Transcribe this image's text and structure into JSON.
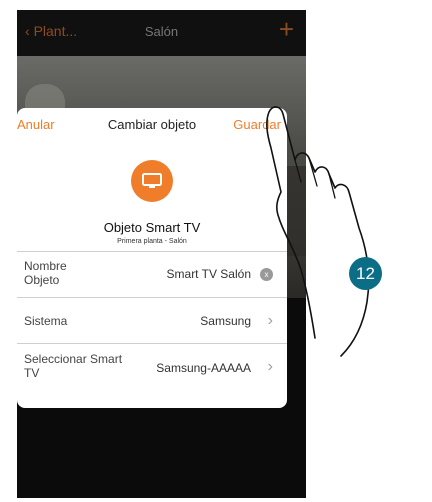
{
  "navbar": {
    "back": "Plant...",
    "title": "Salón",
    "add": "+"
  },
  "modal": {
    "cancel": "Anular",
    "title": "Cambiar objeto",
    "save": "Guardar",
    "object_name": "Objeto Smart TV",
    "object_location": "Primera planta - Salón",
    "rows": [
      {
        "label": "Nombre Objeto",
        "value": "Smart TV Salón"
      },
      {
        "label": "Sistema",
        "value": "Samsung"
      },
      {
        "label": "Seleccionar Smart TV",
        "value": "Samsung-AAAAA"
      }
    ],
    "clear_glyph": "x",
    "chevron_glyph": "›"
  },
  "step": {
    "number": "12"
  },
  "colors": {
    "accent": "#f07d2a",
    "step_badge": "#0b6e86"
  }
}
